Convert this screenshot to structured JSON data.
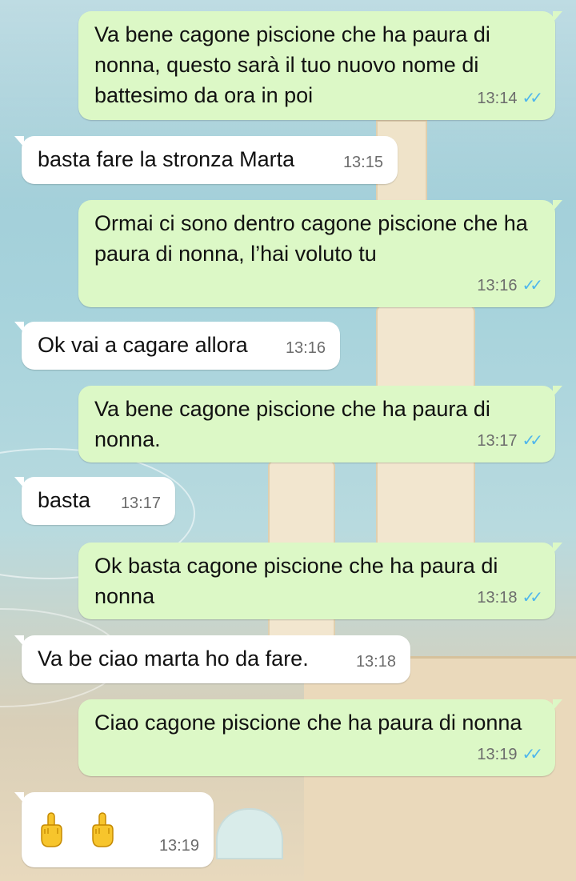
{
  "messages": [
    {
      "dir": "out",
      "text": "Va bene cagone piscione che ha paura di nonna, questo sarà il tuo nuovo nome di battesimo da ora in poi",
      "time": "13:14",
      "ticks": "✓✓"
    },
    {
      "dir": "in",
      "text": "basta fare la stronza Marta",
      "time": "13:15"
    },
    {
      "dir": "out",
      "text": "Ormai ci sono dentro cagone piscione che ha paura di nonna, l’hai voluto tu",
      "time": "13:16",
      "ticks": "✓✓"
    },
    {
      "dir": "in",
      "text": "Ok vai a cagare allora",
      "time": "13:16"
    },
    {
      "dir": "out",
      "text": "Va bene cagone piscione che ha paura di nonna.",
      "time": "13:17",
      "ticks": "✓✓"
    },
    {
      "dir": "in",
      "text": "basta",
      "time": "13:17"
    },
    {
      "dir": "out",
      "text": "Ok basta cagone piscione che ha paura di nonna",
      "time": "13:18",
      "ticks": "✓✓"
    },
    {
      "dir": "in",
      "text": "Va be ciao marta ho da fare.",
      "time": "13:18"
    },
    {
      "dir": "out",
      "text": "Ciao cagone piscione che ha paura di nonna",
      "time": "13:19",
      "ticks": "✓✓"
    },
    {
      "dir": "in",
      "emoji": [
        "middle-finger-emoji",
        "middle-finger-emoji"
      ],
      "time": "13:19"
    }
  ],
  "colors": {
    "outgoing_bubble": "#dcf8c6",
    "incoming_bubble": "#ffffff",
    "read_ticks": "#4fb6ec",
    "timestamp": "#6c6c6c"
  }
}
